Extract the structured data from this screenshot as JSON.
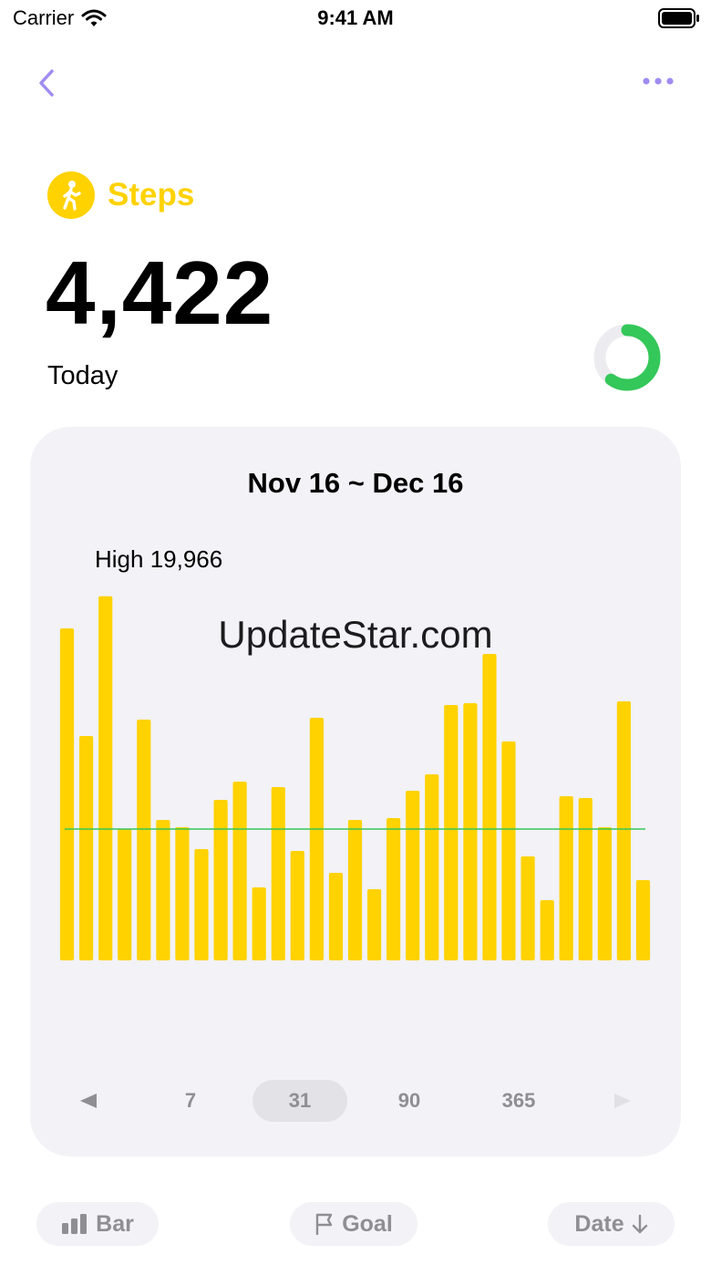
{
  "status_bar": {
    "carrier": "Carrier",
    "time": "9:41 AM"
  },
  "nav": {
    "back_icon": "chevron-left-icon",
    "more_icon": "ellipsis-icon"
  },
  "metric": {
    "title": "Steps",
    "icon": "walking-figure-icon",
    "value": "4,422",
    "caption": "Today",
    "goal_progress": 0.6,
    "accent_color": "#ffd200",
    "ring_color": "#34c759"
  },
  "chart_card": {
    "range_label": "Nov 16 ~ Dec 16",
    "high_label": "High 19,966",
    "watermark": "UpdateStar.com",
    "ranges": [
      "7",
      "31",
      "90",
      "365"
    ],
    "selected_range": "31",
    "prev_icon": "triangle-left-icon",
    "next_icon": "triangle-right-icon"
  },
  "chart_data": {
    "type": "bar",
    "title": "",
    "series": [
      {
        "values": [
          18200,
          12300,
          19966,
          7200,
          13200,
          7700,
          7300,
          6100,
          8800,
          9800,
          4000,
          9500,
          6000,
          13300,
          4800,
          7700,
          3900,
          7800,
          9300,
          10200,
          14000,
          14100,
          16800,
          12000,
          5700,
          3300,
          9000,
          8900,
          7300,
          14200,
          4400
        ],
        "color": "#ffd200"
      }
    ],
    "reference_line": {
      "value": 7200,
      "color": "#34c759"
    },
    "ylim": [
      0,
      20000
    ],
    "grid": false
  },
  "bottom_bar": {
    "chart_type_label": "Bar",
    "chart_type_icon": "bar-chart-icon",
    "goal_label": "Goal",
    "goal_icon": "flag-icon",
    "sort_label": "Date",
    "sort_icon": "arrow-down-icon"
  }
}
